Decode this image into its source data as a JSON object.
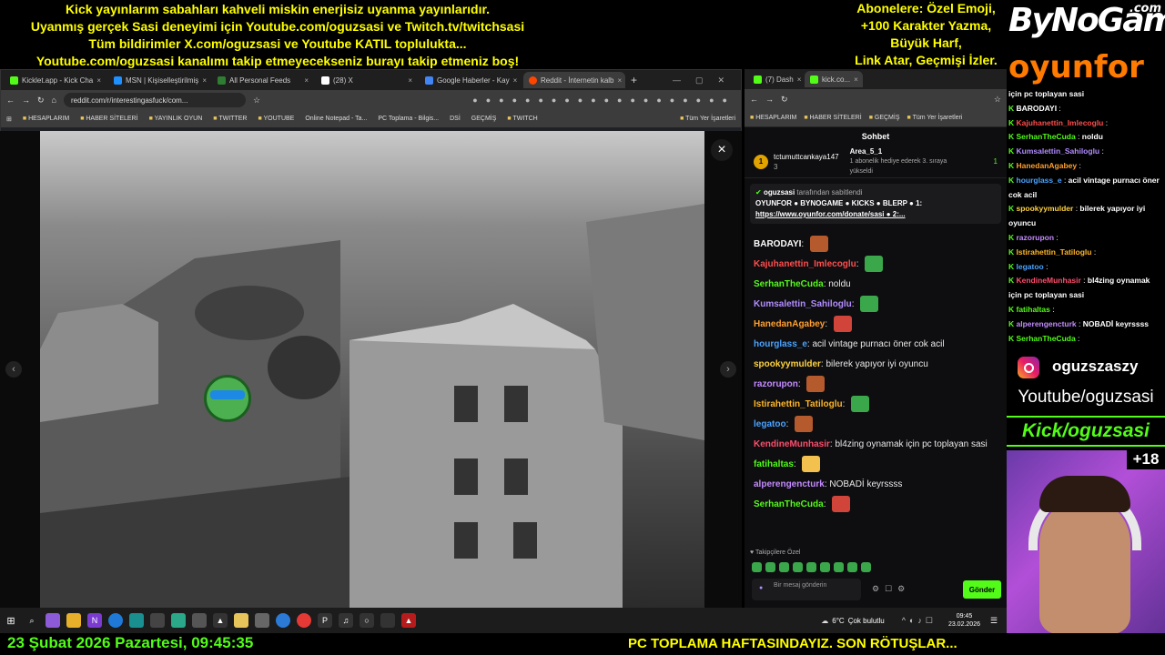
{
  "overlay": {
    "top_left_lines": [
      "Kick yayınlarım sabahları kahveli miskin enerjisiz uyanma yayınlarıdır.",
      "Uyanmış gerçek Sasi deneyimi için Youtube.com/oguzsasi ve Twitch.tv/twitchsasi",
      "Tüm bildirimler X.com/oguzsasi ve Youtube KATIL toplulukta...",
      "Youtube.com/oguzsasi kanalımı takip etmeyecekseniz burayı takip etmeniz boş!"
    ],
    "top_right_lines": [
      "Abonelere: Özel Emoji,",
      "+100 Karakter Yazma,",
      "Büyük Harf,",
      "Link Atar, Geçmişi İzler."
    ],
    "bynogame_logo": "ByNoGame",
    "bynogame_suffix": ".com",
    "oyunfor_logo": "oyunfor",
    "instagram_handle": "oguzszaszy",
    "youtube_text": "Youtube/oguzsasi",
    "kick_text": "Kick/oguzsasi",
    "plus_count": "+18",
    "bottom_left": "23 Şubat 2026 Pazartesi, 09:45:35",
    "bottom_right": "PC TOPLAMA HAFTASINDAYIZ. SON RÖTUŞLAR..."
  },
  "browser": {
    "tabs": [
      {
        "label": "Kicklet.app - Kick Cha",
        "color": "#53fc18",
        "active": false
      },
      {
        "label": "MSN | Kişiselleştirilmiş",
        "color": "#1e90ff",
        "active": false
      },
      {
        "label": "All Personal Feeds",
        "color": "#2e7d32",
        "active": false
      },
      {
        "label": "(28) X",
        "color": "#ffffff",
        "active": false
      },
      {
        "label": "Google Haberler - Kay",
        "color": "#4285f4",
        "active": false
      },
      {
        "label": "Reddit - İnternetin kalb",
        "color": "#ff4500",
        "active": true
      }
    ],
    "url": "reddit.com/r/interestingasfuck/com...",
    "bookmarks": [
      "HESAPLARIM",
      "HABER SİTELERİ",
      "YAYINLIK OYUN",
      "TWITTER",
      "YOUTUBE",
      "Online Notepad - Ta...",
      "PC Toplama - Bilgis...",
      "DSİ",
      "GEÇMİŞ",
      "TWITCH",
      "Tüm Yer İşaretleri"
    ]
  },
  "chat_window": {
    "tabs": [
      "(7) Dash",
      "kick.co..."
    ],
    "bookmarks": [
      "HESAPLARIM",
      "HABER SİTELERİ",
      "GEÇMİŞ",
      "Tüm Yer İşaretleri"
    ],
    "title": "Sohbet",
    "top_gifter": "tctumuttcankaya147",
    "top_gifter_count": "3",
    "gift_user": "Area_5_1",
    "gift_note": "1 abonelik hediye ederek 3. sıraya yükseldi",
    "gift_count": "1",
    "pinned_by": "oguzsasi",
    "pinned_label": "tarafından sabitlendi",
    "pinned_text": "OYUNFOR ● BYNOGAME ● KICKS ● BLERP ● 1:",
    "pinned_link": "https://www.oyunfor.com/donate/sasi ● 2:...",
    "messages": [
      {
        "user": "BARODAYI",
        "color": "#ffffff",
        "text": "",
        "emote": "#b55a2d"
      },
      {
        "user": "Kajuhanettin_Imlecoglu",
        "color": "#ff4d4d",
        "text": "",
        "emote": "#3aa84a"
      },
      {
        "user": "SerhanTheCuda",
        "color": "#53fc18",
        "text": "noldu",
        "emote": ""
      },
      {
        "user": "Kumsalettin_Sahiloglu",
        "color": "#b28cff",
        "text": "",
        "emote": "#3aa84a"
      },
      {
        "user": "HanedanAgabey",
        "color": "#ff9f2e",
        "text": "",
        "emote": "#d0443a"
      },
      {
        "user": "hourglass_e",
        "color": "#4aa3ff",
        "text": "acil vintage purnacı öner cok acil",
        "emote": ""
      },
      {
        "user": "spookyymulder",
        "color": "#ffd23f",
        "text": "bilerek yapıyor iyi oyuncu",
        "emote": ""
      },
      {
        "user": "razorupon",
        "color": "#c48bff",
        "text": "",
        "emote": "#b55a2d"
      },
      {
        "user": "Istirahettin_Tatiloglu",
        "color": "#ffb627",
        "text": "",
        "emote": "#3aa84a"
      },
      {
        "user": "legatoo",
        "color": "#4aa3ff",
        "text": "",
        "emote": "#b55a2d"
      },
      {
        "user": "KendineMunhasir",
        "color": "#ff4d6d",
        "text": "bl4zing oynamak için pc toplayan sasi",
        "emote": ""
      },
      {
        "user": "fatihaltas",
        "color": "#53fc18",
        "text": "",
        "emote": "#f2c14e"
      },
      {
        "user": "alperengencturk",
        "color": "#c48bff",
        "text": "NOBADİ keyrssss",
        "emote": ""
      },
      {
        "user": "SerhanTheCuda",
        "color": "#53fc18",
        "text": "",
        "emote": "#d0443a"
      }
    ],
    "followers_only": "Takipçilere Özel",
    "input_placeholder": "Bir mesaj gönderin",
    "send_label": "Gönder"
  },
  "side_chat": [
    {
      "user": "",
      "text": "için pc toplayan sasi"
    },
    {
      "user": "BARODAYI",
      "text": ""
    },
    {
      "user": "Kajuhanettin_Imlecoglu",
      "text": ""
    },
    {
      "user": "SerhanTheCuda",
      "text": "noldu"
    },
    {
      "user": "Kumsalettin_Sahiloglu",
      "text": ""
    },
    {
      "user": "HanedanAgabey",
      "text": ""
    },
    {
      "user": "hourglass_e",
      "text": "acil vintage purnacı öner cok acil"
    },
    {
      "user": "spookyymulder",
      "text": "bilerek yapıyor iyi oyuncu"
    },
    {
      "user": "razorupon",
      "text": ""
    },
    {
      "user": "Istirahettin_Tatiloglu",
      "text": ""
    },
    {
      "user": "legatoo",
      "text": ""
    },
    {
      "user": "KendineMunhasir",
      "text": "bl4zing oynamak için pc toplayan sasi"
    },
    {
      "user": "fatihaltas",
      "text": ""
    },
    {
      "user": "alperengencturk",
      "text": "NOBADİ keyrssss"
    },
    {
      "user": "SerhanTheCuda",
      "text": ""
    }
  ],
  "taskbar": {
    "weather_temp": "6°C",
    "weather_text": "Çok bulutlu",
    "time": "09:45",
    "date": "23.02.2026"
  }
}
